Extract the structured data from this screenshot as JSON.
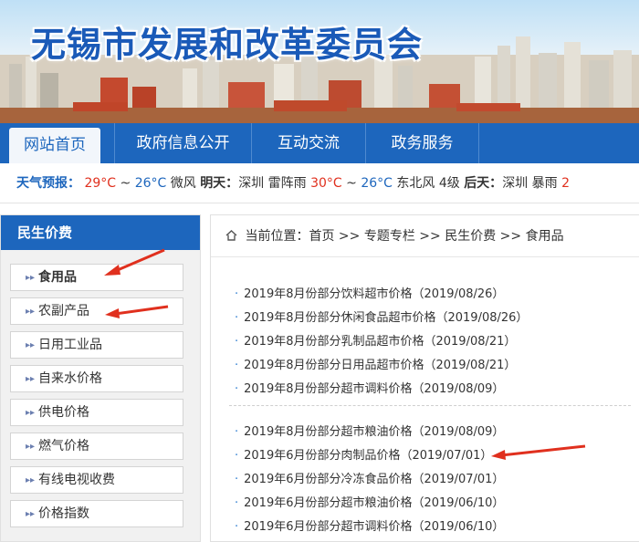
{
  "site": {
    "title": "无锡市发展和改革委员会"
  },
  "nav": {
    "items": [
      {
        "label": "网站首页",
        "active": true
      },
      {
        "label": "政府信息公开"
      },
      {
        "label": "互动交流"
      },
      {
        "label": "政务服务"
      }
    ]
  },
  "weather": {
    "label": "天气预报：",
    "today_hi": "29°C",
    "today_sep": " ~ ",
    "today_lo": "26°C",
    "today_wind": "微风",
    "tomorrow_label": "明天：",
    "tomorrow_city": "深圳",
    "tomorrow_cond": "雷阵雨",
    "tomorrow_hi": "30°C",
    "tomorrow_sep": " ~ ",
    "tomorrow_lo": "26°C",
    "tomorrow_wind": "东北风 4级",
    "after_label": "后天：",
    "after_city": "深圳",
    "after_cond": "暴雨",
    "after_hi": "2"
  },
  "sidebar": {
    "title": "民生价费",
    "items": [
      {
        "label": "食用品"
      },
      {
        "label": "农副产品"
      },
      {
        "label": "日用工业品"
      },
      {
        "label": "自来水价格"
      },
      {
        "label": "供电价格"
      },
      {
        "label": "燃气价格"
      },
      {
        "label": "有线电视收费"
      },
      {
        "label": "价格指数"
      }
    ]
  },
  "breadcrumb": {
    "label": "当前位置：",
    "path": [
      "首页",
      "专题专栏",
      "民生价费",
      "食用品"
    ],
    "separator": ">>"
  },
  "news": {
    "group1": [
      "2019年8月份部分饮料超市价格（2019/08/26）",
      "2019年8月份部分休闲食品超市价格（2019/08/26）",
      "2019年8月份部分乳制品超市价格（2019/08/21）",
      "2019年8月份部分日用品超市价格（2019/08/21）",
      "2019年8月份部分超市调料价格（2019/08/09）"
    ],
    "group2": [
      "2019年8月份部分超市粮油价格（2019/08/09）",
      "2019年6月份部分肉制品价格（2019/07/01）",
      "2019年6月份部分冷冻食品价格（2019/07/01）",
      "2019年6月份部分超市粮油价格（2019/06/10）",
      "2019年6月份部分超市调料价格（2019/06/10）"
    ]
  },
  "colors": {
    "brand": "#1d66bd",
    "annotation": "#e0301e"
  }
}
